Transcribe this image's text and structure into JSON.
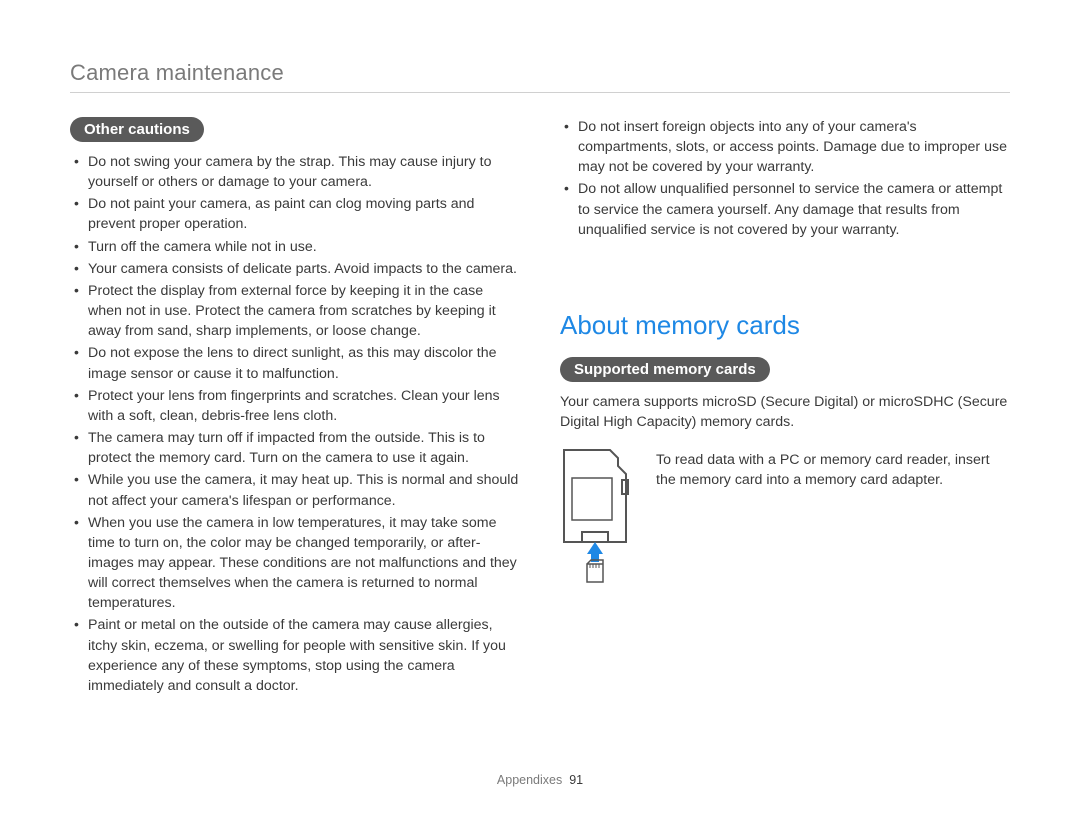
{
  "header": {
    "title": "Camera maintenance"
  },
  "left": {
    "pill": "Other cautions",
    "bullets": [
      "Do not swing your camera by the strap. This may cause injury to yourself or others or damage to your camera.",
      "Do not paint your camera, as paint can clog moving parts and prevent proper operation.",
      "Turn off the camera while not in use.",
      "Your camera consists of delicate parts. Avoid impacts to the camera.",
      "Protect the display from external force by keeping it in the case when not in use. Protect the camera from scratches by keeping it away from sand, sharp implements, or loose change.",
      "Do not expose the lens to direct sunlight, as this may discolor the image sensor or cause it to malfunction.",
      "Protect your lens from fingerprints and scratches. Clean your lens with a soft, clean, debris-free lens cloth.",
      "The camera may turn off if impacted from the outside. This is to protect the memory card. Turn on the camera to use it again.",
      "While you use the camera, it may heat up. This is normal and should not affect your camera's lifespan or performance.",
      "When you use the camera in low temperatures, it may take some time to turn on, the color may be changed temporarily, or after-images may appear. These conditions are not malfunctions and they will correct themselves when the camera is returned to normal temperatures.",
      "Paint or metal on the outside of the camera may cause allergies, itchy skin, eczema, or swelling for people with sensitive skin. If you experience any of these symptoms, stop using the camera immediately and consult a doctor."
    ]
  },
  "right": {
    "top_bullets": [
      "Do not insert foreign objects into any of your camera's compartments, slots, or access points. Damage due to improper use may not be covered by your warranty.",
      "Do not allow unqualified personnel to service the camera or attempt to service the camera yourself. Any damage that results from unqualified service is not covered by your warranty."
    ],
    "section_title": "About memory cards",
    "pill": "Supported memory cards",
    "body": "Your camera supports microSD (Secure Digital) or microSDHC (Secure Digital High Capacity) memory cards.",
    "caption": "To read data with a PC or memory card reader, insert the memory card into a memory card adapter."
  },
  "footer": {
    "section": "Appendixes",
    "page": "91"
  }
}
